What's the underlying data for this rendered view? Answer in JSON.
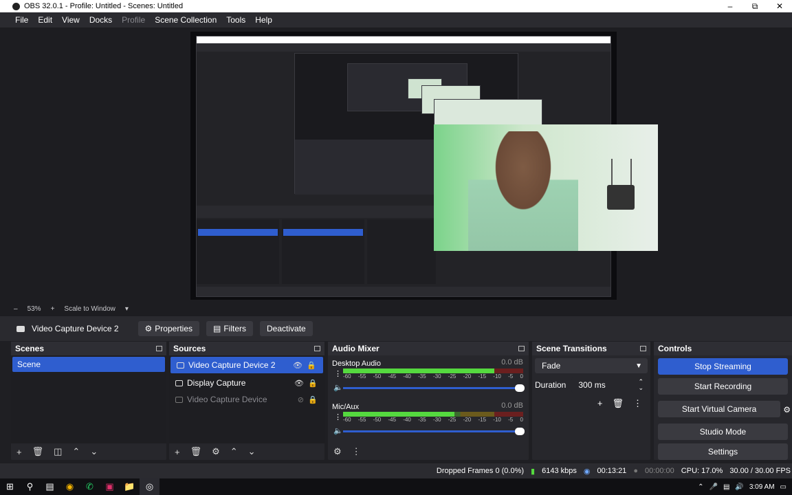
{
  "window": {
    "title": "OBS 32.0.1 - Profile: Untitled - Scenes: Untitled",
    "minimize": "–",
    "maximize": "⧉",
    "close": "✕"
  },
  "menu": [
    "File",
    "Edit",
    "View",
    "Docks",
    "Profile",
    "Scene Collection",
    "Tools",
    "Help"
  ],
  "preview_bar": {
    "zoom_minus": "–",
    "zoom": "53%",
    "zoom_plus": "+",
    "scale_mode": "Scale to Window",
    "dropdown": "▾"
  },
  "source_toolbar": {
    "source_name": "Video Capture Device 2",
    "properties": "Properties",
    "filters": "Filters",
    "deactivate": "Deactivate"
  },
  "scenes": {
    "title": "Scenes",
    "items": [
      "Scene"
    ],
    "selected": 0
  },
  "sources": {
    "title": "Sources",
    "items": [
      {
        "name": "Video Capture Device 2",
        "selected": true,
        "visible": true
      },
      {
        "name": "Display Capture",
        "selected": false,
        "visible": true
      },
      {
        "name": "Video Capture Device",
        "selected": false,
        "visible": false
      }
    ]
  },
  "audio_mixer": {
    "title": "Audio Mixer",
    "channels": [
      {
        "name": "Desktop Audio",
        "db": "0.0 dB",
        "level": 0.84
      },
      {
        "name": "Mic/Aux",
        "db": "0.0 dB",
        "level": 0.62
      }
    ],
    "scale": [
      "-60",
      "-55",
      "-50",
      "-45",
      "-40",
      "-35",
      "-30",
      "-25",
      "-20",
      "-15",
      "-10",
      "-5",
      "0"
    ]
  },
  "transitions": {
    "title": "Scene Transitions",
    "type": "Fade",
    "duration_label": "Duration",
    "duration": "300 ms"
  },
  "controls": {
    "title": "Controls",
    "buttons": [
      "Stop Streaming",
      "Start Recording",
      "Start Virtual Camera",
      "Studio Mode",
      "Settings"
    ]
  },
  "status": {
    "dropped": "Dropped Frames 0 (0.0%)",
    "bitrate": "6143 kbps",
    "stream_time": "00:13:21",
    "rec_time": "00:00:00",
    "cpu": "CPU: 17.0%",
    "fps": "30.00 / 30.00 FPS"
  },
  "taskbar": {
    "clock": "3:09 AM"
  },
  "colors": {
    "accent": "#2f5ecf",
    "meter_green": "#55d93f",
    "panel": "#27272c",
    "background": "#1f1f23"
  }
}
